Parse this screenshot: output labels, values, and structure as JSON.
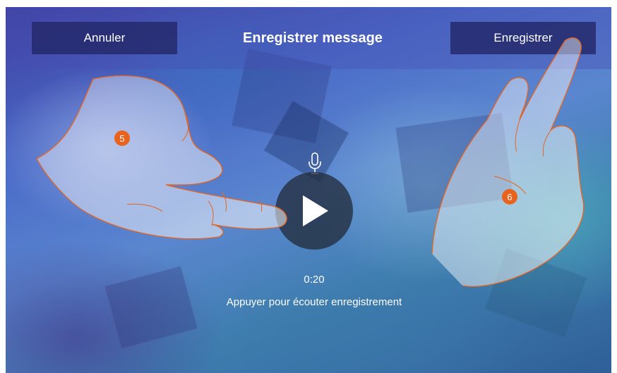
{
  "header": {
    "cancel_label": "Annuler",
    "title": "Enregistrer message",
    "save_label": "Enregistrer"
  },
  "player": {
    "mic_icon": "microphone-icon",
    "play_icon": "play-icon",
    "time": "0:20",
    "hint": "Appuyer pour écouter enregistrement"
  },
  "callouts": [
    {
      "label": "5",
      "color": "#e8641e"
    },
    {
      "label": "6",
      "color": "#e8641e"
    }
  ],
  "colors": {
    "hand_outline": "#e8641e",
    "button_bg": "#232869",
    "text": "#ffffff"
  }
}
